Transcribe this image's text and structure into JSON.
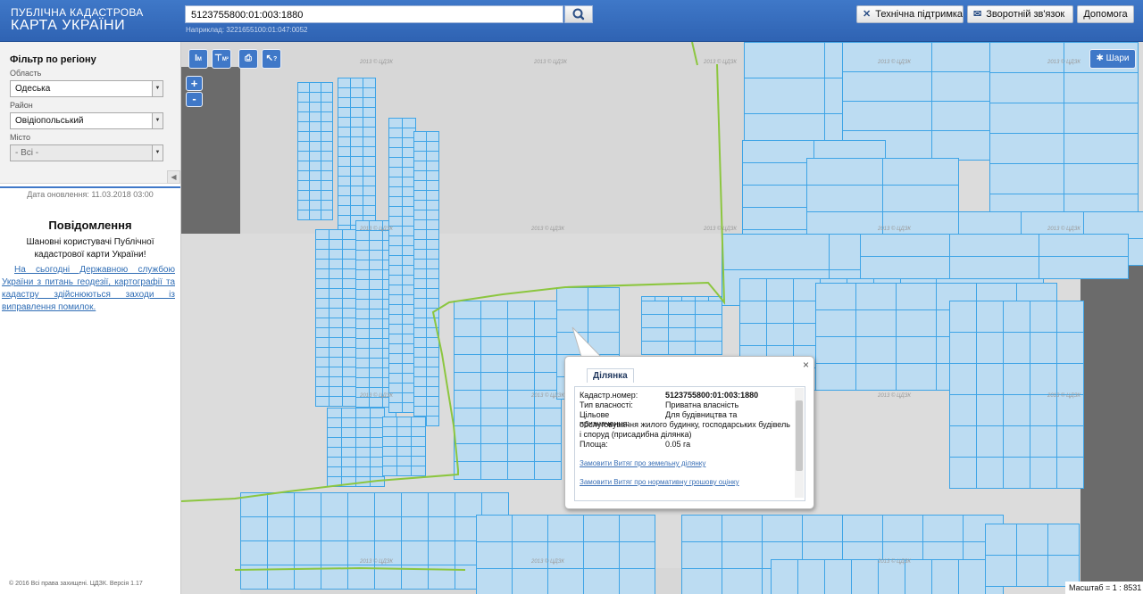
{
  "header": {
    "logo_line1": "ПУБЛІЧНА КАДАСТРОВА",
    "logo_line2": "КАРТА УКРАЇНИ",
    "search_value": "5123755800:01:003:1880",
    "search_hint": "Наприклад: 3221655100:01:047:0052",
    "buttons": {
      "support": "Технічна підтримка",
      "feedback": "Зворотній зв'язок",
      "help": "Допомога"
    }
  },
  "sidebar": {
    "filter_title": "Фільтр по регіону",
    "region_label": "Область",
    "region_value": "Одеська",
    "district_label": "Район",
    "district_value": "Овідіопольський",
    "city_label": "Місто",
    "city_value": "- Всі -",
    "update_date": "Дата оновлення: 11.03.2018 03:00",
    "notice_title": "Повідомлення",
    "notice_text": "Шановні користувачі Публічної кадастрової карти України!",
    "notice_link": "На сьогодні Державною службою України з питань геодезії, картографії та кадастру здійснюються заходи із виправлення помилок.",
    "copyright": "© 2016 Всі права захищені. ЦДЗК. Версія 1.17"
  },
  "map": {
    "layers_button": "Шари",
    "watermark": "2013 © ЦДЗК",
    "scale": "Масштаб = 1 : 8531",
    "tools": [
      "ruler-length-icon",
      "ruler-area-icon",
      "print-icon",
      "info-cursor-icon"
    ]
  },
  "popup": {
    "tab": "Ділянка",
    "close": "×",
    "rows": [
      {
        "key": "Кадастр.номер:",
        "value": "5123755800:01:003:1880"
      },
      {
        "key": "Тип власності:",
        "value": "Приватна власність"
      },
      {
        "key": "Цільове призначення:",
        "value": "Для будівництва та обслуговування жилого будинку, господарських будівель і споруд (присадибна ділянка)"
      },
      {
        "key": "Площа:",
        "value": "0.05 га"
      }
    ],
    "link_extract": "Замовити Витяг про земельну ділянку",
    "link_valuation": "Замовити Витяг про нормативну грошову оцінку"
  },
  "colors": {
    "header_blue": "#3f78c8",
    "parcel_fill": "#bcdcf2",
    "parcel_border": "#3ea4e6",
    "boundary_green": "#8cc63f"
  }
}
